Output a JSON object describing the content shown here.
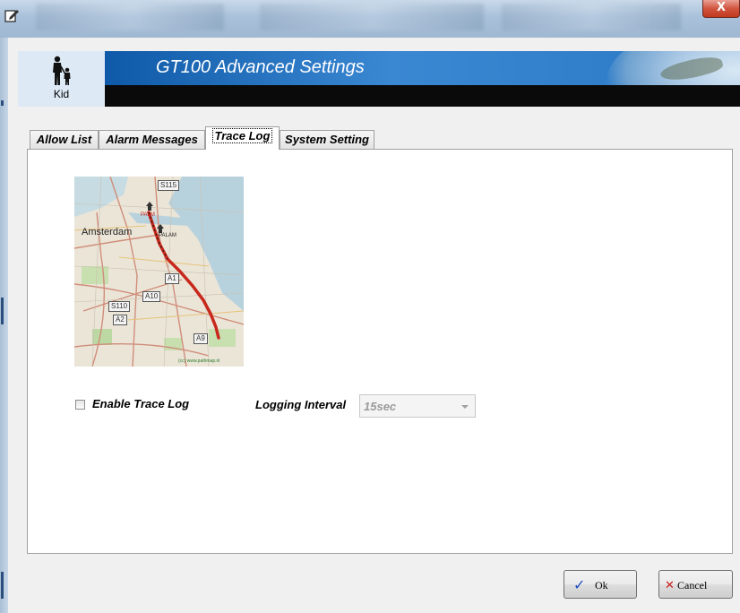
{
  "window": {
    "close_glyph": "X"
  },
  "header": {
    "profile_label": "Kid",
    "profile_icon": "parent-child-icon",
    "title": "GT100 Advanced Settings"
  },
  "tabs": [
    {
      "label": "Allow List",
      "active": false
    },
    {
      "label": "Alarm Messages",
      "active": false
    },
    {
      "label": "Trace Log",
      "active": true
    },
    {
      "label": "System Setting",
      "active": false
    }
  ],
  "trace_log": {
    "map": {
      "city_label": "Amsterdam",
      "markers": [
        "PALM",
        "PALAM"
      ],
      "road_shields": [
        "S115",
        "A1",
        "A10",
        "S110",
        "A2",
        "A9"
      ],
      "credit": "(cc) www.pathmap.nl",
      "track_color": "#c8281c"
    },
    "enable_label": "Enable Trace Log",
    "enable_checked": false,
    "interval_label": "Logging Interval",
    "interval_value": "15sec",
    "interval_enabled": false
  },
  "buttons": {
    "ok_label": "Ok",
    "cancel_label": "Cancel",
    "ok_icon": "checkmark-icon",
    "cancel_icon": "x-icon"
  },
  "colors": {
    "banner_blue": "#2b79c6",
    "check_blue": "#1f4fbf",
    "cancel_red": "#c81e1e"
  }
}
